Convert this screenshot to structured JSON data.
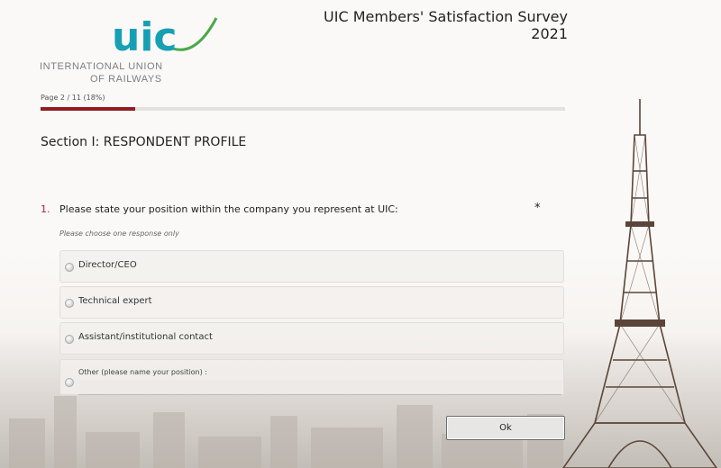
{
  "logo": {
    "mark_text": "uic",
    "line1": "INTERNATIONAL UNION",
    "line2": "OF RAILWAYS",
    "colors": {
      "teal": "#17a0b3",
      "green": "#4aa84a",
      "gray": "#7a7f85"
    }
  },
  "header": {
    "title": "UIC Members' Satisfaction Survey 2021"
  },
  "progress": {
    "page_text": "Page 2 / 11  (18%)",
    "percent": 18,
    "color": "#8e1d23"
  },
  "section": {
    "title": "Section I: RESPONDENT PROFILE"
  },
  "question": {
    "number": "1.",
    "text": "Please state your position within the company you represent at UIC:",
    "required_mark": "*",
    "hint": "Please choose one response only",
    "options": [
      {
        "label": "Director/CEO"
      },
      {
        "label": "Technical expert"
      },
      {
        "label": "Assistant/institutional contact"
      }
    ],
    "other": {
      "label": "Other (please name your position) :",
      "value": ""
    }
  },
  "actions": {
    "ok_label": "Ok"
  },
  "background": {
    "icon": "eiffel-tower-icon"
  }
}
